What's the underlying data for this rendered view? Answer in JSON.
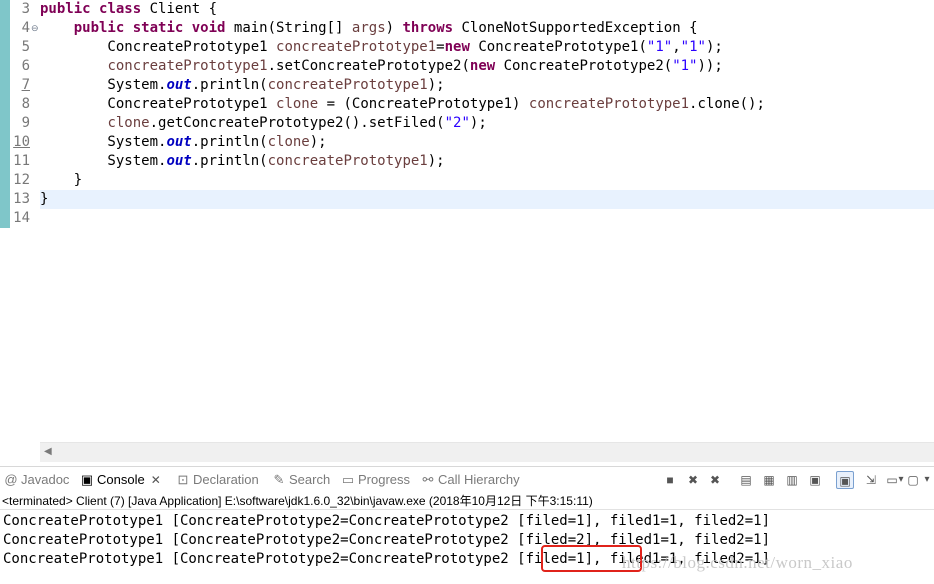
{
  "editor": {
    "lines": [
      {
        "no": "3",
        "segments": [
          {
            "t": "public",
            "c": "kw"
          },
          {
            "t": " "
          },
          {
            "t": "class",
            "c": "kw"
          },
          {
            "t": " Client {"
          }
        ]
      },
      {
        "no": "4",
        "fold": "⊖",
        "segments": [
          {
            "t": "    "
          },
          {
            "t": "public",
            "c": "kw"
          },
          {
            "t": " "
          },
          {
            "t": "static",
            "c": "kw"
          },
          {
            "t": " "
          },
          {
            "t": "void",
            "c": "kw"
          },
          {
            "t": " main(String[] "
          },
          {
            "t": "args",
            "c": "var"
          },
          {
            "t": ") "
          },
          {
            "t": "throws",
            "c": "kw"
          },
          {
            "t": " CloneNotSupportedException {"
          }
        ]
      },
      {
        "no": "5",
        "segments": [
          {
            "t": "        ConcreatePrototype1 "
          },
          {
            "t": "concreatePrototype1",
            "c": "var"
          },
          {
            "t": "="
          },
          {
            "t": "new",
            "c": "kw"
          },
          {
            "t": " ConcreatePrototype1("
          },
          {
            "t": "\"1\"",
            "c": "str"
          },
          {
            "t": ","
          },
          {
            "t": "\"1\"",
            "c": "str"
          },
          {
            "t": ");"
          }
        ]
      },
      {
        "no": "6",
        "segments": [
          {
            "t": "        "
          },
          {
            "t": "concreatePrototype1",
            "c": "var"
          },
          {
            "t": ".setConcreatePrototype2("
          },
          {
            "t": "new",
            "c": "kw"
          },
          {
            "t": " ConcreatePrototype2("
          },
          {
            "t": "\"1\"",
            "c": "str"
          },
          {
            "t": "));"
          }
        ]
      },
      {
        "no": "7",
        "ul": true,
        "segments": [
          {
            "t": "        System."
          },
          {
            "t": "out",
            "c": "fld"
          },
          {
            "t": ".println("
          },
          {
            "t": "concreatePrototype1",
            "c": "var"
          },
          {
            "t": ");"
          }
        ]
      },
      {
        "no": "8",
        "segments": [
          {
            "t": "        ConcreatePrototype1 "
          },
          {
            "t": "clone",
            "c": "var"
          },
          {
            "t": " = (ConcreatePrototype1) "
          },
          {
            "t": "concreatePrototype1",
            "c": "var"
          },
          {
            "t": ".clone();"
          }
        ]
      },
      {
        "no": "9",
        "segments": [
          {
            "t": "        "
          },
          {
            "t": "clone",
            "c": "var"
          },
          {
            "t": ".getConcreatePrototype2().setFiled("
          },
          {
            "t": "\"2\"",
            "c": "str"
          },
          {
            "t": ");"
          }
        ]
      },
      {
        "no": "10",
        "ul": true,
        "segments": [
          {
            "t": "        System."
          },
          {
            "t": "out",
            "c": "fld"
          },
          {
            "t": ".println("
          },
          {
            "t": "clone",
            "c": "var"
          },
          {
            "t": ");"
          }
        ]
      },
      {
        "no": "11",
        "segments": [
          {
            "t": "        System."
          },
          {
            "t": "out",
            "c": "fld"
          },
          {
            "t": ".println("
          },
          {
            "t": "concreatePrototype1",
            "c": "var"
          },
          {
            "t": ");"
          }
        ]
      },
      {
        "no": "12",
        "segments": [
          {
            "t": "    }"
          }
        ]
      },
      {
        "no": "13",
        "current": true,
        "segments": [
          {
            "t": "}"
          }
        ]
      },
      {
        "no": "14",
        "segments": []
      }
    ]
  },
  "console": {
    "tabs": [
      {
        "label": "Javadoc",
        "icon": "@",
        "icon_name": "javadoc-icon"
      },
      {
        "label": "Console",
        "icon": "▣",
        "icon_name": "console-icon",
        "active": true,
        "close": "✕"
      },
      {
        "label": "Declaration",
        "icon": "⊡",
        "icon_name": "declaration-icon"
      },
      {
        "label": "Search",
        "icon": "✎",
        "icon_name": "search-icon"
      },
      {
        "label": "Progress",
        "icon": "▭",
        "icon_name": "progress-icon"
      },
      {
        "label": "Call Hierarchy",
        "icon": "⚯",
        "icon_name": "call-hierarchy-icon"
      }
    ],
    "toolbar": [
      {
        "icon": "■",
        "name": "terminate-icon"
      },
      {
        "icon": "✖",
        "name": "remove-launch-icon"
      },
      {
        "icon": "✖",
        "name": "remove-all-terminated-icon"
      },
      {
        "icon": "▤",
        "name": "clear-console-icon"
      },
      {
        "icon": "▦",
        "name": "scroll-lock-icon"
      },
      {
        "icon": "▥",
        "name": "word-wrap-icon"
      },
      {
        "icon": "▣",
        "name": "show-console-on-output-icon"
      },
      {
        "icon": "▣",
        "name": "show-console-on-error-icon"
      },
      {
        "icon": "⇲",
        "name": "pin-console-icon"
      },
      {
        "icon": "▭",
        "name": "display-selected-console-icon"
      },
      {
        "icon": "▾",
        "name": "display-console-dropdown-icon"
      },
      {
        "icon": "▢",
        "name": "open-console-icon"
      },
      {
        "icon": "▾",
        "name": "open-console-dropdown-icon"
      }
    ],
    "status": "<terminated> Client (7) [Java Application] E:\\software\\jdk1.6.0_32\\bin\\javaw.exe (2018年10月12日 下午3:15:11)",
    "output": [
      "ConcreatePrototype1 [ConcreatePrototype2=ConcreatePrototype2 [filed=1], filed1=1, filed2=1]",
      "ConcreatePrototype1 [ConcreatePrototype2=ConcreatePrototype2 [filed=2], filed1=1, filed2=1]",
      "ConcreatePrototype1 [ConcreatePrototype2=ConcreatePrototype2 [filed=1], filed1=1, filed2=1]"
    ],
    "highlight_color": "#e0231b"
  },
  "watermark": "https://blog.csdn.net/worn_xiao"
}
